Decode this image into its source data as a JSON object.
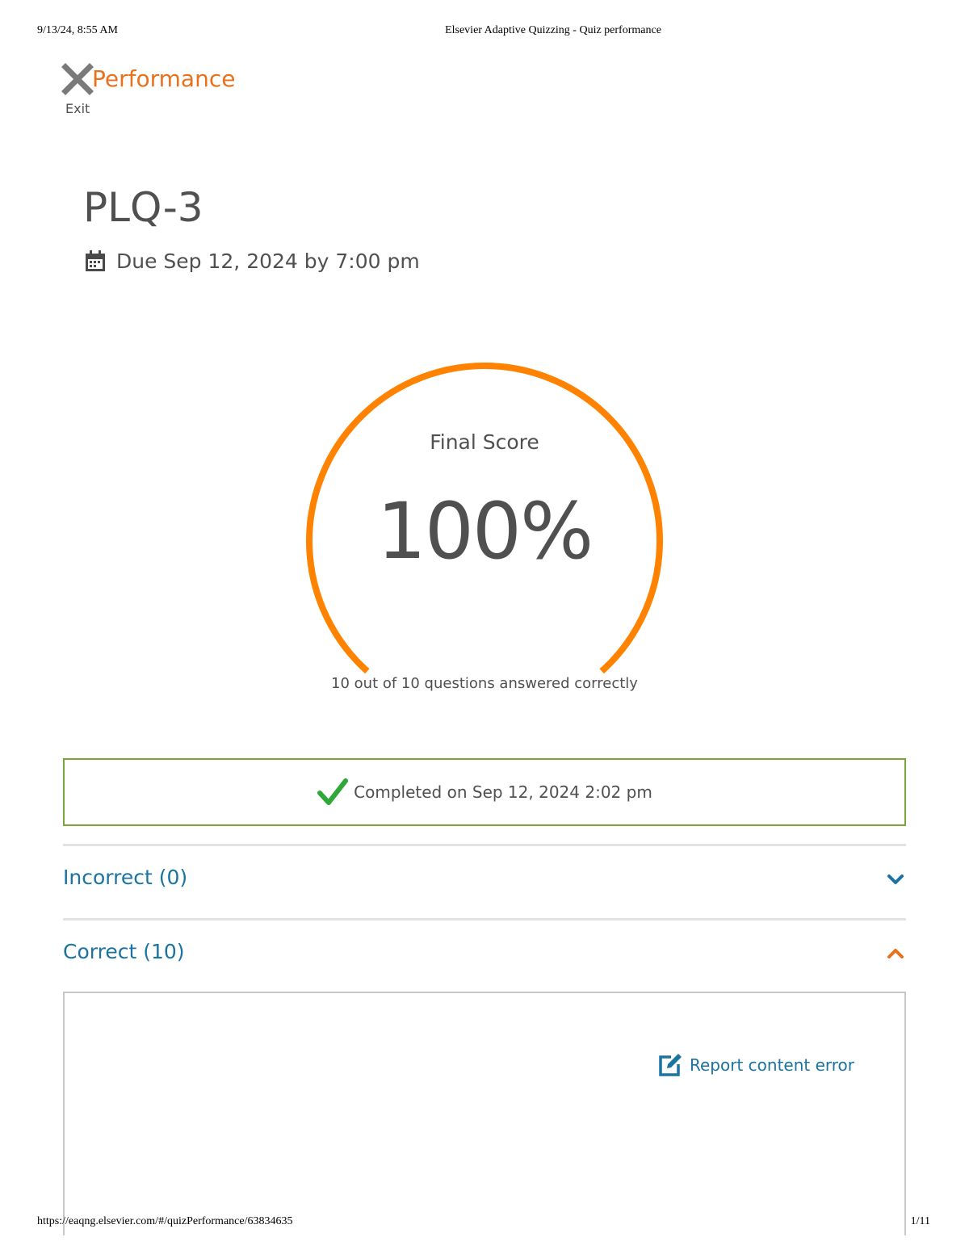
{
  "print_header": {
    "datetime": "9/13/24, 8:55 AM",
    "page_title": "Elsevier Adaptive Quizzing - Quiz performance"
  },
  "print_footer": {
    "url": "https://eaqng.elsevier.com/#/quizPerformance/63834635",
    "page_number": "1/11"
  },
  "header": {
    "title": "Performance",
    "exit_label": "Exit",
    "exit_icon": "close-icon"
  },
  "quiz": {
    "title": "PLQ-3",
    "due": "Due Sep 12, 2024 by 7:00 pm",
    "due_icon": "calendar-icon"
  },
  "score": {
    "label": "Final Score",
    "value": "100%",
    "fraction": 1.0,
    "summary": "10 out of 10 questions answered correctly",
    "color": "#ff8200"
  },
  "completed": {
    "text": "Completed on Sep 12, 2024 2:02 pm",
    "icon": "check-icon",
    "border_color": "#7aa63a"
  },
  "sections": {
    "incorrect": {
      "label": "Incorrect (0)",
      "expanded": false,
      "icon": "chevron-down-icon"
    },
    "correct": {
      "label": "Correct (10)",
      "expanded": true,
      "icon": "chevron-up-icon"
    }
  },
  "question_panel": {
    "report_label": "Report content error",
    "report_icon": "edit-icon"
  },
  "colors": {
    "accent": "#e9711c",
    "link": "#1a73a0",
    "text": "#505050"
  }
}
